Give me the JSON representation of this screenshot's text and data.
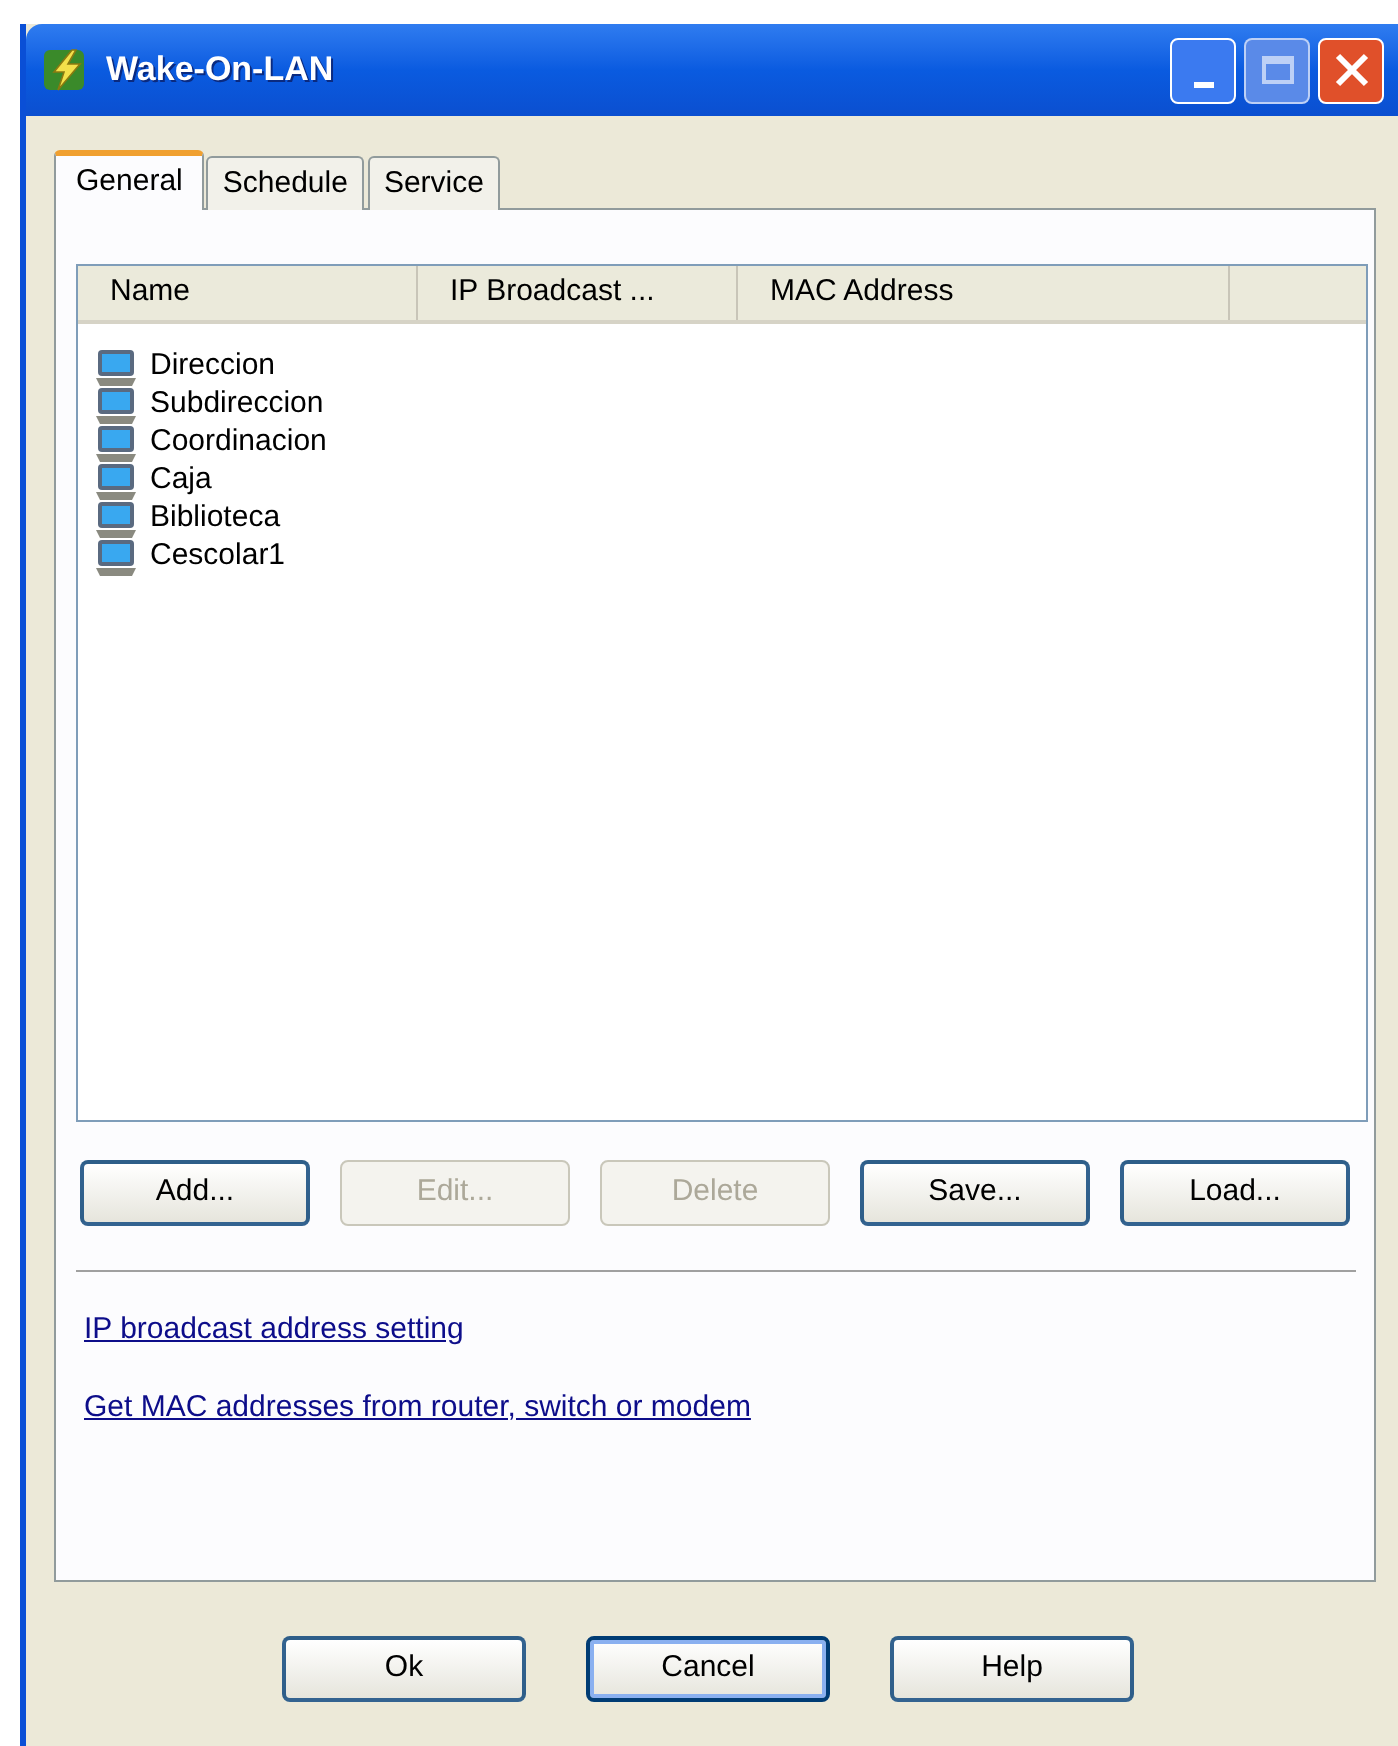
{
  "window": {
    "title": "Wake-On-LAN"
  },
  "tabs": [
    {
      "label": "General",
      "selected": true
    },
    {
      "label": "Schedule",
      "selected": false
    },
    {
      "label": "Service",
      "selected": false
    }
  ],
  "list": {
    "columns": [
      "Name",
      "IP Broadcast ...",
      "MAC Address"
    ],
    "rows": [
      {
        "name": "Direccion"
      },
      {
        "name": "Subdireccion"
      },
      {
        "name": "Coordinacion"
      },
      {
        "name": "Caja"
      },
      {
        "name": "Biblioteca"
      },
      {
        "name": "Cescolar1"
      }
    ]
  },
  "buttons": [
    {
      "label": "Add...",
      "disabled": false
    },
    {
      "label": "Edit...",
      "disabled": true
    },
    {
      "label": "Delete",
      "disabled": true
    },
    {
      "label": "Save...",
      "disabled": false
    },
    {
      "label": "Load...",
      "disabled": false
    }
  ],
  "links": [
    "IP broadcast address setting",
    "Get MAC addresses from router, switch or modem"
  ],
  "dialog_buttons": [
    {
      "label": "Ok",
      "focused": false
    },
    {
      "label": "Cancel",
      "focused": true
    },
    {
      "label": "Help",
      "focused": false
    }
  ]
}
